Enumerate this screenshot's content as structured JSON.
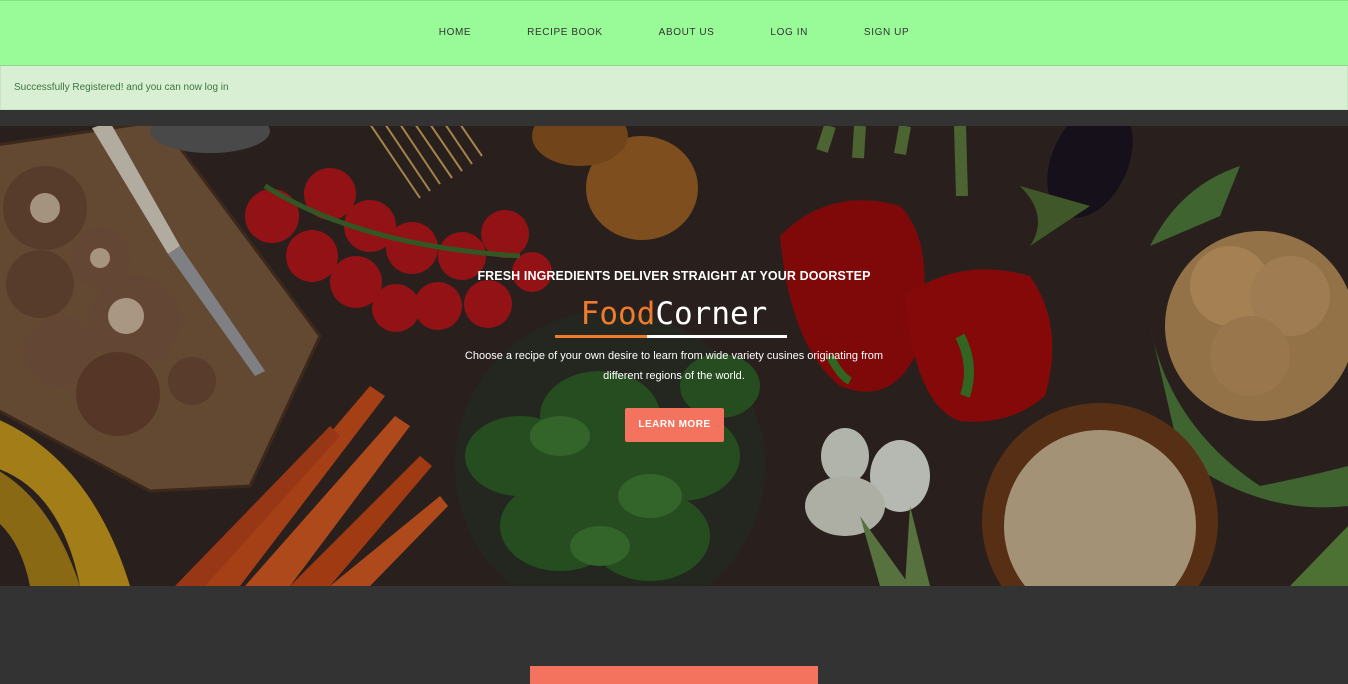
{
  "nav": {
    "items": [
      {
        "label": "HOME",
        "name": "nav-home"
      },
      {
        "label": "RECIPE BOOK",
        "name": "nav-recipe-book"
      },
      {
        "label": "ABOUT US",
        "name": "nav-about-us"
      },
      {
        "label": "LOG IN",
        "name": "nav-log-in"
      },
      {
        "label": "SIGN UP",
        "name": "nav-sign-up"
      }
    ]
  },
  "alert": {
    "message": "Successfully Registered! and you can now log in"
  },
  "hero": {
    "kicker": "FRESH INGREDIENTS DELIVER STRAIGHT AT YOUR DOORSTEP",
    "logo_part1": "Food",
    "logo_part2": "Corner",
    "description": "Choose a recipe of your own desire to learn from wide variety cusines originating from different regions of the world.",
    "button_label": "LEARN MORE"
  },
  "colors": {
    "nav_bg": "#98fb98",
    "alert_bg": "#d8efd4",
    "accent": "#f4735e",
    "logo_orange": "#f07b2d",
    "page_bg": "#333333"
  }
}
